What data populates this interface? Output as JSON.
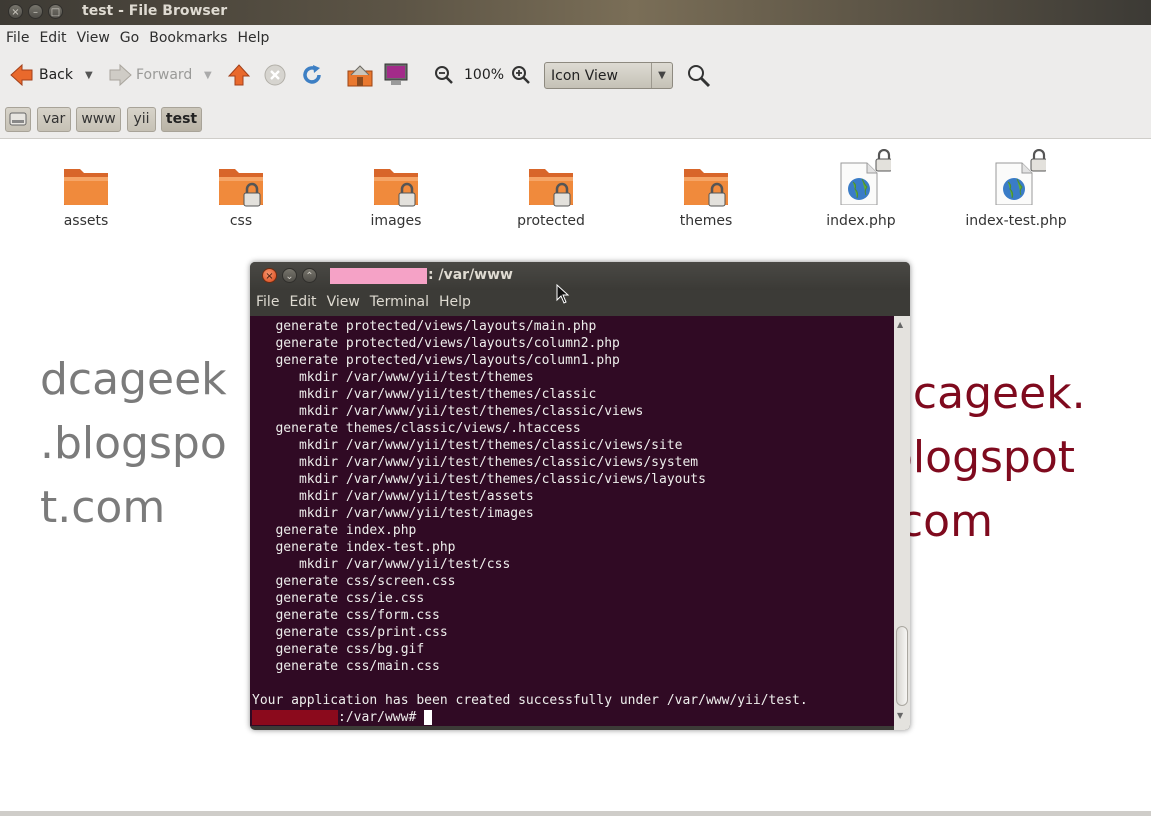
{
  "file_browser": {
    "title": "test - File Browser",
    "menu": [
      "File",
      "Edit",
      "View",
      "Go",
      "Bookmarks",
      "Help"
    ],
    "toolbar": {
      "back_label": "Back",
      "forward_label": "Forward",
      "zoom_level": "100%",
      "view_mode": "Icon View"
    },
    "breadcrumbs": [
      "var",
      "www",
      "yii",
      "test"
    ],
    "files": [
      {
        "name": "assets",
        "type": "folder",
        "locked": false
      },
      {
        "name": "css",
        "type": "folder",
        "locked": true
      },
      {
        "name": "images",
        "type": "folder",
        "locked": true
      },
      {
        "name": "protected",
        "type": "folder",
        "locked": true
      },
      {
        "name": "themes",
        "type": "folder",
        "locked": true
      },
      {
        "name": "index.php",
        "type": "php",
        "locked": true
      },
      {
        "name": "index-test.php",
        "type": "php",
        "locked": true
      }
    ]
  },
  "watermark_left": [
    "dcageek",
    ".blogspo",
    "t.com"
  ],
  "watermark_right": [
    "dcageek.",
    "blogspot",
    ".com"
  ],
  "terminal": {
    "title": ": /var/www",
    "menu": [
      "File",
      "Edit",
      "View",
      "Terminal",
      "Help"
    ],
    "output": "   generate protected/views/layouts/main.php\n   generate protected/views/layouts/column2.php\n   generate protected/views/layouts/column1.php\n      mkdir /var/www/yii/test/themes\n      mkdir /var/www/yii/test/themes/classic\n      mkdir /var/www/yii/test/themes/classic/views\n   generate themes/classic/views/.htaccess\n      mkdir /var/www/yii/test/themes/classic/views/site\n      mkdir /var/www/yii/test/themes/classic/views/system\n      mkdir /var/www/yii/test/themes/classic/views/layouts\n      mkdir /var/www/yii/test/assets\n      mkdir /var/www/yii/test/images\n   generate index.php\n   generate index-test.php\n      mkdir /var/www/yii/test/css\n   generate css/screen.css\n   generate css/ie.css\n   generate css/form.css\n   generate css/print.css\n   generate css/bg.gif\n   generate css/main.css\n\nYour application has been created successfully under /var/www/yii/test.",
    "prompt": ":/var/www#"
  },
  "colors": {
    "terminal_bg": "#300a24",
    "folder_orange": "#f08a3c",
    "watermark_red": "#7f0a1e"
  }
}
